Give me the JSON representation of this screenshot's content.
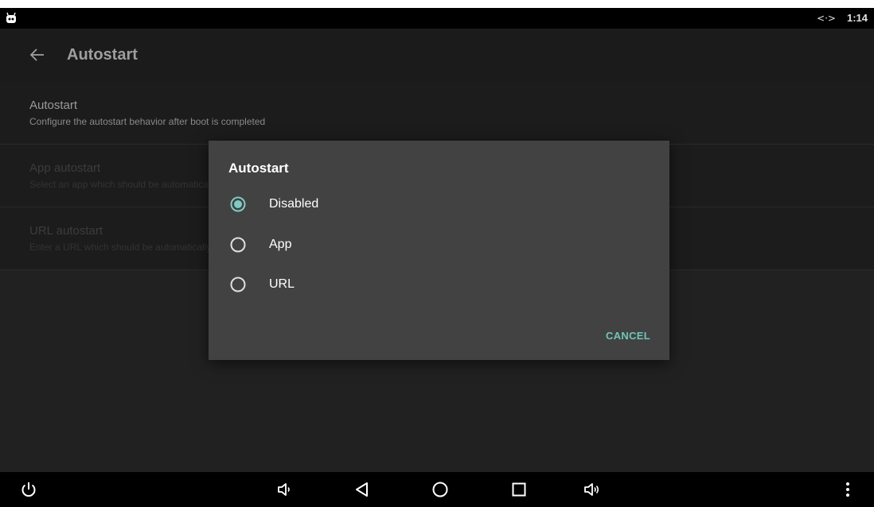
{
  "status_bar": {
    "clock": "1:14",
    "network_icon": "<·>",
    "icons": [
      "android-notification-icon",
      "network-icon"
    ]
  },
  "app_bar": {
    "title": "Autostart",
    "back_icon": "arrow-left-icon"
  },
  "preferences": [
    {
      "title": "Autostart",
      "summary": "Configure the autostart behavior after boot is completed",
      "enabled": true
    },
    {
      "title": "App autostart",
      "summary": "Select an app which should be automatically started",
      "enabled": false
    },
    {
      "title": "URL autostart",
      "summary": "Enter a URL which should be automatically opened",
      "enabled": false
    }
  ],
  "dialog": {
    "title": "Autostart",
    "options": [
      {
        "label": "Disabled",
        "selected": true
      },
      {
        "label": "App",
        "selected": false
      },
      {
        "label": "URL",
        "selected": false
      }
    ],
    "cancel_label": "CANCEL"
  },
  "nav_bar": {
    "icons": [
      "power-icon",
      "volume-down-icon",
      "back-triangle-icon",
      "home-circle-icon",
      "recents-square-icon",
      "volume-up-icon",
      "overflow-menu-icon"
    ]
  },
  "colors": {
    "accent": "#80cbc4",
    "dialog_bg": "#424242",
    "background": "#212121"
  }
}
